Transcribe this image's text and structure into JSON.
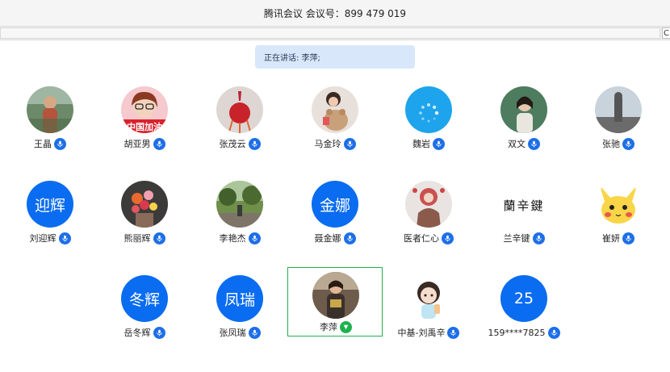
{
  "window": {
    "title": "腾讯会议 会议号：899 479 019"
  },
  "toolbar": {
    "tiny_button_label": "C"
  },
  "banner": {
    "speaking_text": "正在讲话: 李萍;"
  },
  "participants": [
    {
      "name": "王晶",
      "avatar": "photo-woman-outdoors",
      "mic": "on"
    },
    {
      "name": "胡亚男",
      "avatar": "cartoon-girl-中国加油",
      "avatar_text": "中国加油",
      "mic": "on"
    },
    {
      "name": "张茂云",
      "avatar": "photo-red-ornament",
      "mic": "on"
    },
    {
      "name": "马金玲",
      "avatar": "photo-girl-teddy",
      "mic": "on"
    },
    {
      "name": "魏岩",
      "avatar": "loading-spinner",
      "mic": "on"
    },
    {
      "name": "双文",
      "avatar": "photo-woman-trees",
      "mic": "on"
    },
    {
      "name": "张驰",
      "avatar": "photo-statue-sky",
      "mic": "on"
    },
    {
      "name": "刘迎辉",
      "avatar": "text",
      "avatar_text": "迎辉",
      "mic": "on"
    },
    {
      "name": "熊丽辉",
      "avatar": "photo-flowers",
      "mic": "on"
    },
    {
      "name": "李艳杰",
      "avatar": "photo-park",
      "mic": "on"
    },
    {
      "name": "聂金娜",
      "avatar": "text",
      "avatar_text": "金娜",
      "mic": "on"
    },
    {
      "name": "医者仁心",
      "avatar": "photo-doll",
      "mic": "on"
    },
    {
      "name": "兰辛键",
      "avatar": "calligraphy",
      "avatar_text": "蘭辛鍵",
      "mic": "on"
    },
    {
      "name": "崔妍",
      "avatar": "cartoon-pikachu",
      "mic": "on"
    },
    {
      "name": "岳冬辉",
      "avatar": "text",
      "avatar_text": "冬辉",
      "mic": "on"
    },
    {
      "name": "张凤瑞",
      "avatar": "text",
      "avatar_text": "凤瑞",
      "mic": "on"
    },
    {
      "name": "李萍",
      "avatar": "photo-woman-seated",
      "mic": "speaking",
      "active": true
    },
    {
      "name": "中基-刘禹辛",
      "avatar": "cartoon-girl-drink",
      "mic": "on"
    },
    {
      "name": "159****7825",
      "avatar": "text",
      "avatar_text": "25",
      "mic": "on"
    }
  ],
  "colors": {
    "accent_blue": "#0a6cf0",
    "mic_blue": "#1d6fe8",
    "speaking_green": "#20b14e",
    "banner_bg": "#d9e7fb"
  }
}
